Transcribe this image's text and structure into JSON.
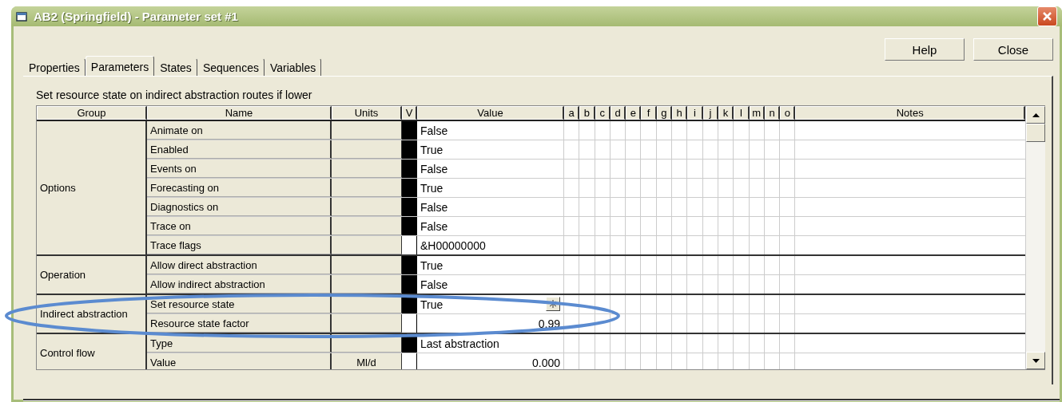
{
  "window": {
    "title": "AB2 (Springfield) - Parameter set #1"
  },
  "tabs": [
    {
      "label": "Properties",
      "selected": false
    },
    {
      "label": "Parameters",
      "selected": true
    },
    {
      "label": "States",
      "selected": false
    },
    {
      "label": "Sequences",
      "selected": false
    },
    {
      "label": "Variables",
      "selected": false
    }
  ],
  "buttons": [
    "Help",
    "Close"
  ],
  "description": "Set resource state on indirect  abstraction routes if lower",
  "table": {
    "columns": {
      "group": "Group",
      "name": "Name",
      "units": "Units",
      "v": "V",
      "value": "Value",
      "flags": [
        "a",
        "b",
        "c",
        "d",
        "e",
        "f",
        "g",
        "h",
        "i",
        "j",
        "k",
        "l",
        "m",
        "n",
        "o"
      ],
      "notes": "Notes"
    },
    "groups": [
      {
        "group": "Options",
        "rows": [
          {
            "name": "Animate on",
            "v_set": true,
            "value": "False",
            "kind": "text"
          },
          {
            "name": "Enabled",
            "v_set": true,
            "value": "True",
            "kind": "text"
          },
          {
            "name": "Events on",
            "v_set": true,
            "value": "False",
            "kind": "text"
          },
          {
            "name": "Forecasting on",
            "v_set": true,
            "value": "True",
            "kind": "text"
          },
          {
            "name": "Diagnostics on",
            "v_set": true,
            "value": "False",
            "kind": "text"
          },
          {
            "name": "Trace on",
            "v_set": true,
            "value": "False",
            "kind": "text"
          },
          {
            "name": "Trace flags",
            "v_set": false,
            "value": "&H00000000",
            "kind": "text"
          }
        ]
      },
      {
        "group": "Operation",
        "rows": [
          {
            "name": "Allow direct abstraction",
            "v_set": true,
            "value": "True",
            "kind": "text"
          },
          {
            "name": "Allow indirect abstraction",
            "v_set": true,
            "value": "False",
            "kind": "text"
          }
        ]
      },
      {
        "group": "Indirect abstraction",
        "rows": [
          {
            "name": "Set resource state",
            "v_set": true,
            "value": "True",
            "kind": "text",
            "edit_button": true
          },
          {
            "name": "Resource state factor",
            "v_set": false,
            "value": "0.99",
            "kind": "number"
          }
        ]
      },
      {
        "group": "Control flow",
        "rows": [
          {
            "name": "Type",
            "v_set": true,
            "value": "Last abstraction",
            "kind": "text"
          },
          {
            "name": "Value",
            "units": "Ml/d",
            "v_set": false,
            "value": "0.000",
            "kind": "number"
          }
        ]
      }
    ]
  }
}
